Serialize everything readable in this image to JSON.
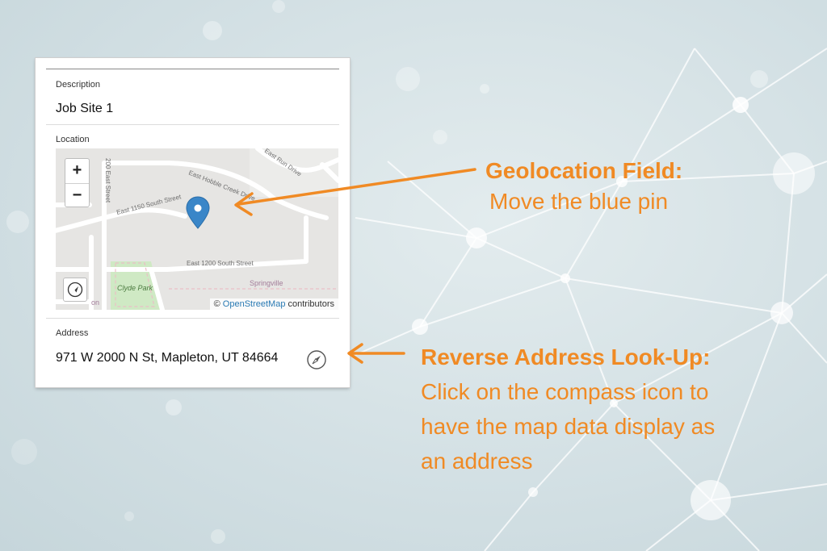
{
  "form": {
    "description": {
      "label": "Description",
      "value": "Job Site 1"
    },
    "location": {
      "label": "Location"
    },
    "address": {
      "label": "Address",
      "value": "971 W 2000 N St, Mapleton, UT 84664"
    }
  },
  "map": {
    "zoom_in": "+",
    "zoom_out": "−",
    "streets": {
      "s200e": "200 East Street",
      "hobble": "East Hobble Creek Drive",
      "run": "East Run Drive",
      "s1150": "East 1150 South Street",
      "s1200": "East 1200 South Street"
    },
    "places": {
      "clyde": "Clyde Park",
      "springville": "Springville",
      "on": "on"
    },
    "attribution": {
      "symbol": "©",
      "link": "OpenStreetMap",
      "text": "contributors"
    },
    "pin_color": "#3a86c8"
  },
  "callouts": {
    "geo": {
      "title": "Geolocation Field:",
      "text": "Move the blue pin"
    },
    "reverse": {
      "title": "Reverse Address Look-Up:",
      "lines": [
        "Click on the compass icon to",
        "have the map data display as",
        "an address"
      ]
    }
  },
  "colors": {
    "accent": "#f08a24"
  }
}
